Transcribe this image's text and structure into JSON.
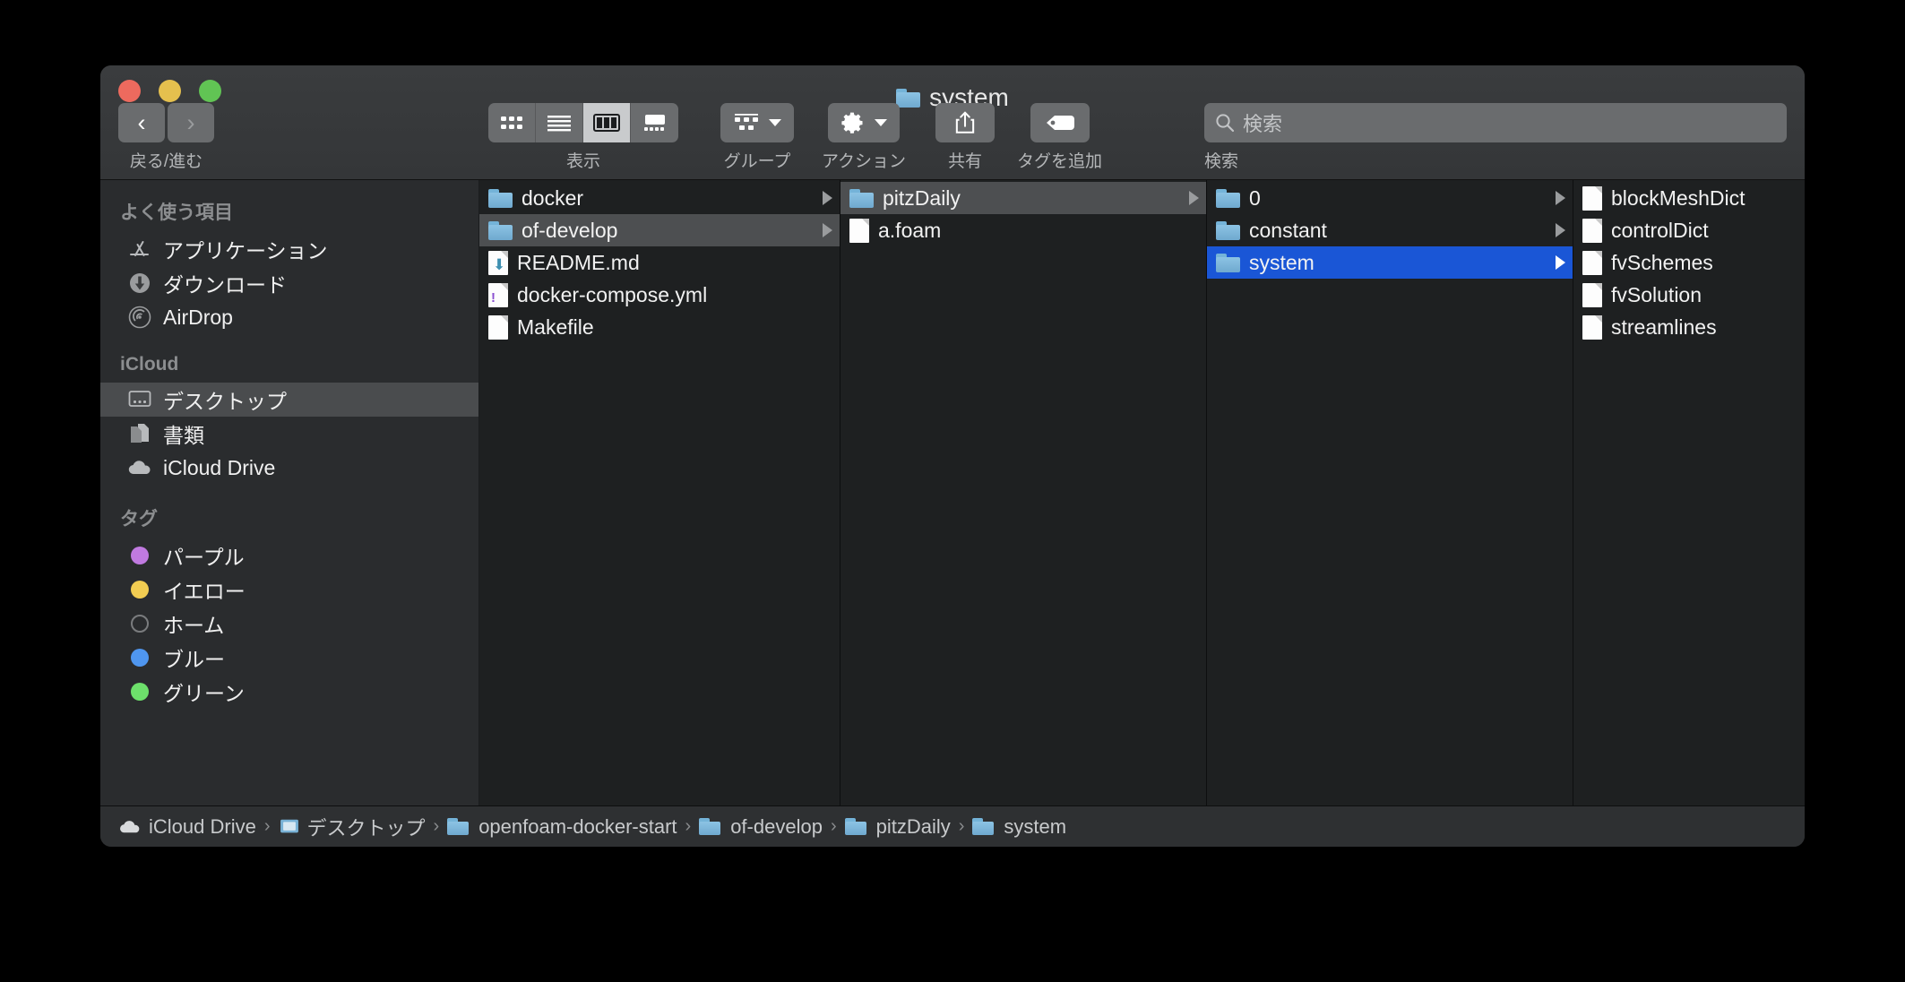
{
  "window": {
    "title": "system",
    "title_icon": "folder-icon",
    "traffic_lights": [
      {
        "name": "close",
        "color": "#ed6a5e"
      },
      {
        "name": "minimize",
        "color": "#e5c04e"
      },
      {
        "name": "zoom",
        "color": "#61c454"
      }
    ]
  },
  "toolbar": {
    "nav_label": "戻る/進む",
    "back_icon": "chevron-left-icon",
    "forward_icon": "chevron-right-icon",
    "view_label": "表示",
    "view_modes": [
      {
        "name": "icon-view",
        "icon": "grid-icon",
        "active": false
      },
      {
        "name": "list-view",
        "icon": "list-icon",
        "active": false
      },
      {
        "name": "column-view",
        "icon": "columns-icon",
        "active": true
      },
      {
        "name": "gallery-view",
        "icon": "gallery-icon",
        "active": false
      }
    ],
    "group_label": "グループ",
    "group_icon": "group-icon",
    "action_label": "アクション",
    "action_icon": "gear-icon",
    "share_label": "共有",
    "share_icon": "share-icon",
    "tag_label": "タグを追加",
    "tag_icon": "tag-icon"
  },
  "search": {
    "label": "検索",
    "placeholder": "検索",
    "value": "",
    "icon": "search-icon"
  },
  "sidebar": {
    "sections": [
      {
        "header": "よく使う項目",
        "items": [
          {
            "label": "アプリケーション",
            "icon": "applications-icon",
            "selected": false
          },
          {
            "label": "ダウンロード",
            "icon": "downloads-icon",
            "selected": false
          },
          {
            "label": "AirDrop",
            "icon": "airdrop-icon",
            "selected": false
          }
        ]
      },
      {
        "header": "iCloud",
        "items": [
          {
            "label": "デスクトップ",
            "icon": "desktop-icon",
            "selected": true
          },
          {
            "label": "書類",
            "icon": "documents-icon",
            "selected": false
          },
          {
            "label": "iCloud Drive",
            "icon": "icloud-icon",
            "selected": false
          }
        ]
      },
      {
        "header": "タグ",
        "items": [
          {
            "label": "パープル",
            "icon": "tag-dot-icon",
            "color": "#c07ae0",
            "selected": false
          },
          {
            "label": "イエロー",
            "icon": "tag-dot-icon",
            "color": "#f2cd52",
            "selected": false
          },
          {
            "label": "ホーム",
            "icon": "tag-dot-icon",
            "color": "none",
            "selected": false
          },
          {
            "label": "ブルー",
            "icon": "tag-dot-icon",
            "color": "#4f96ef",
            "selected": false
          },
          {
            "label": "グリーン",
            "icon": "tag-dot-icon",
            "color": "#6de06b",
            "selected": false
          }
        ]
      }
    ]
  },
  "columns": [
    {
      "items": [
        {
          "name": "docker",
          "type": "folder",
          "selected": false,
          "has_children": true
        },
        {
          "name": "of-develop",
          "type": "folder",
          "selected": "gray",
          "has_children": true
        },
        {
          "name": "README.md",
          "type": "file",
          "badge": "download-arrow",
          "selected": false,
          "has_children": false
        },
        {
          "name": "docker-compose.yml",
          "type": "file",
          "badge": "!",
          "badge_color": "#8a4fd0",
          "selected": false,
          "has_children": false
        },
        {
          "name": "Makefile",
          "type": "file",
          "selected": false,
          "has_children": false
        }
      ]
    },
    {
      "items": [
        {
          "name": "pitzDaily",
          "type": "folder",
          "selected": "gray",
          "has_children": true
        },
        {
          "name": "a.foam",
          "type": "file",
          "selected": false,
          "has_children": false
        }
      ]
    },
    {
      "items": [
        {
          "name": "0",
          "type": "folder",
          "selected": false,
          "has_children": true
        },
        {
          "name": "constant",
          "type": "folder",
          "selected": false,
          "has_children": true
        },
        {
          "name": "system",
          "type": "folder",
          "selected": "blue",
          "has_children": true
        }
      ]
    },
    {
      "items": [
        {
          "name": "blockMeshDict",
          "type": "file",
          "selected": false,
          "has_children": false
        },
        {
          "name": "controlDict",
          "type": "file",
          "selected": false,
          "has_children": false
        },
        {
          "name": "fvSchemes",
          "type": "file",
          "selected": false,
          "has_children": false
        },
        {
          "name": "fvSolution",
          "type": "file",
          "selected": false,
          "has_children": false
        },
        {
          "name": "streamlines",
          "type": "file",
          "selected": false,
          "has_children": false
        }
      ]
    }
  ],
  "pathbar": {
    "separator": "›",
    "crumbs": [
      {
        "label": "iCloud Drive",
        "icon": "icloud-icon"
      },
      {
        "label": "デスクトップ",
        "icon": "desktop-icon"
      },
      {
        "label": "openfoam-docker-start",
        "icon": "folder-icon"
      },
      {
        "label": "of-develop",
        "icon": "folder-icon"
      },
      {
        "label": "pitzDaily",
        "icon": "folder-icon"
      },
      {
        "label": "system",
        "icon": "folder-icon"
      }
    ]
  },
  "colors": {
    "accent_blue": "#1a56d6",
    "folder_blue": "#7fb8dc",
    "window_bg": "#2a2c2e",
    "column_bg": "#1e2021"
  }
}
